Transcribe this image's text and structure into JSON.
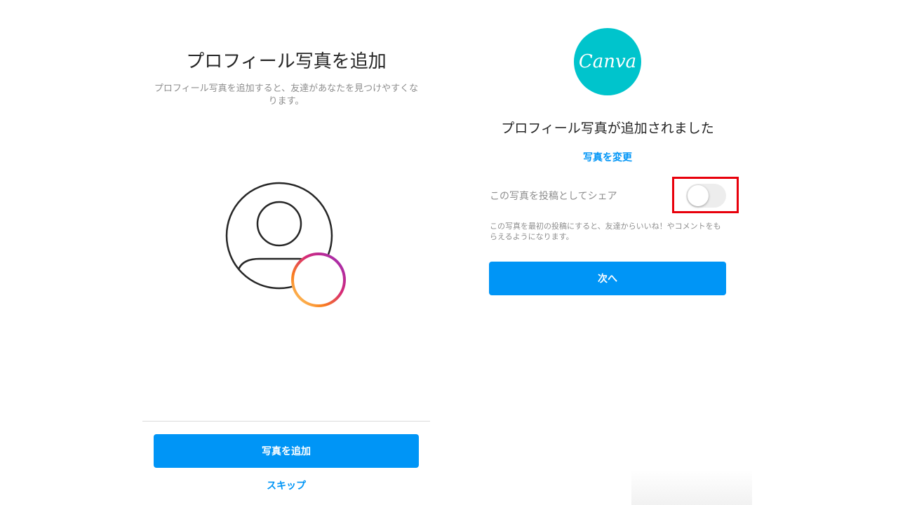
{
  "left_panel": {
    "title": "プロフィール写真を追加",
    "description": "プロフィール写真を追加すると、友達があなたを見つけやすくなります。",
    "add_photo_button": "写真を追加",
    "skip_link": "スキップ"
  },
  "right_panel": {
    "logo_text": "Canva",
    "title": "プロフィール写真が追加されました",
    "change_photo_link": "写真を変更",
    "share_toggle_label": "この写真を投稿としてシェア",
    "share_toggle_on": false,
    "share_note": "この写真を最初の投稿にすると、友達からいいね！やコメントをもらえるようになります。",
    "next_button": "次へ"
  },
  "colors": {
    "primary_blue": "#0095f6",
    "canva_teal": "#00c4cc",
    "highlight_red": "#e8000b",
    "instagram_gradient": [
      "#feda75",
      "#fa7e1e",
      "#d62976",
      "#962fbf"
    ]
  },
  "icons": {
    "avatar": "user-avatar-icon",
    "add": "plus-circle-icon"
  }
}
